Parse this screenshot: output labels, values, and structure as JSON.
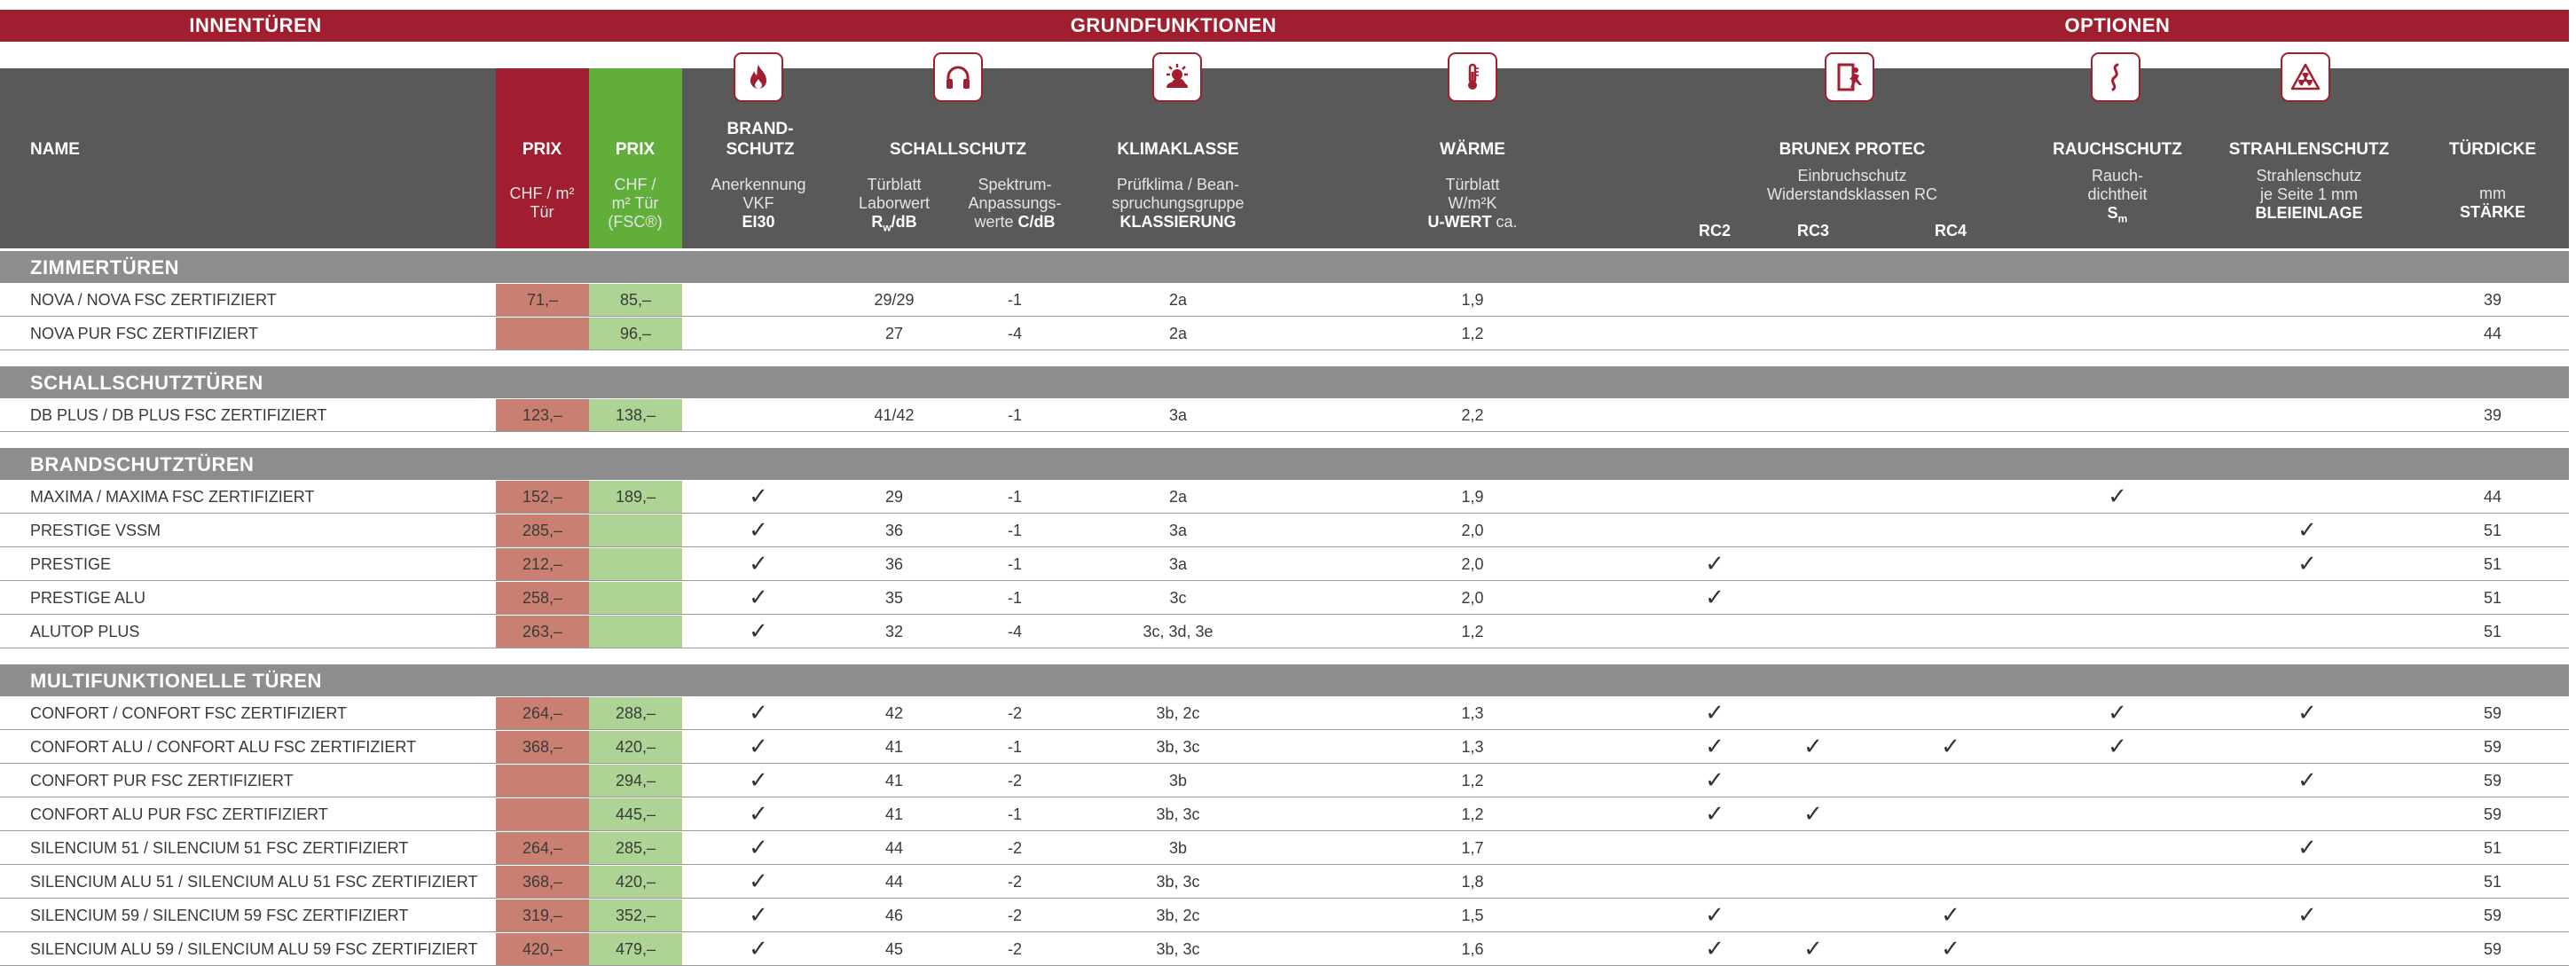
{
  "top_band": {
    "innenturen": "INNENTÜREN",
    "grundfunktionen": "GRUNDFUNKTIONEN",
    "optionen": "OPTIONEN"
  },
  "icons": [
    "flame-icon",
    "headphones-icon",
    "climate-icon",
    "thermometer-icon",
    "intruder-door-icon",
    "smoke-icon",
    "radiation-icon"
  ],
  "headers": {
    "name": "NAME",
    "prix1": "PRIX",
    "prix2": "PRIX",
    "brand1": "BRAND-",
    "brand2": "SCHUTZ",
    "schall": "SCHALLSCHUTZ",
    "klima": "KLIMAKLASSE",
    "warme": "WÄRME",
    "brunex": "BRUNEX PROTEC",
    "rauch": "RAUCHSCHUTZ",
    "strahlen": "STRAHLENSCHUTZ",
    "turdicke": "TÜRDICKE"
  },
  "subheaders": {
    "prix1_a": "CHF / m²",
    "prix1_b": "Tür",
    "prix2_a": "CHF /",
    "prix2_b": "m² Tür",
    "prix2_c": "(FSC®)",
    "brand_a": "Anerkennung",
    "brand_b": "VKF",
    "brand_c": "EI30",
    "labor_a": "Türblatt",
    "labor_b": "Laborwert",
    "labor_c": "Rw/dB",
    "spek_a": "Spektrum-",
    "spek_b": "Anpassungs-",
    "spek_c1": "werte ",
    "spek_c2": "C/dB",
    "klima_a": "Prüfklima / Bean-",
    "klima_b": "spruchungsgruppe",
    "klima_c": "KLASSIERUNG",
    "warme_a": "Türblatt",
    "warme_b": "W/m²K",
    "warme_c1": "U-WERT",
    "warme_c2": " ca.",
    "brunex_a": "Einbruchschutz",
    "brunex_b": "Widerstandsklassen RC",
    "rc2": "RC2",
    "rc3": "RC3",
    "rc4": "RC4",
    "rauch_a": "Rauch-",
    "rauch_b": "dichtheit",
    "rauch_c": "Sm",
    "strahl_a": "Strahlenschutz",
    "strahl_b": "je Seite 1 mm",
    "strahl_c": "BLEIEINLAGE",
    "dicke_a": "mm",
    "dicke_b": "STÄRKE"
  },
  "sections": [
    {
      "title": "ZIMMERTÜREN",
      "rows": [
        {
          "name": "NOVA / NOVA FSC ZERTIFIZIERT",
          "prix": "71,–",
          "prix_fsc": "85,–",
          "brand": "",
          "rw": "29/29",
          "c": "-1",
          "klima": "2a",
          "u": "1,9",
          "rc2": "",
          "rc3": "",
          "rc4": "",
          "rauch": "",
          "strahl": "",
          "mm": "39"
        },
        {
          "name": "NOVA PUR FSC ZERTIFIZIERT",
          "prix": "",
          "prix_fsc": "96,–",
          "brand": "",
          "rw": "27",
          "c": "-4",
          "klima": "2a",
          "u": "1,2",
          "rc2": "",
          "rc3": "",
          "rc4": "",
          "rauch": "",
          "strahl": "",
          "mm": "44"
        }
      ]
    },
    {
      "title": "SCHALLSCHUTZTÜREN",
      "rows": [
        {
          "name": "DB PLUS / DB PLUS FSC ZERTIFIZIERT",
          "prix": "123,–",
          "prix_fsc": "138,–",
          "brand": "",
          "rw": "41/42",
          "c": "-1",
          "klima": "3a",
          "u": "2,2",
          "rc2": "",
          "rc3": "",
          "rc4": "",
          "rauch": "",
          "strahl": "",
          "mm": "39"
        }
      ]
    },
    {
      "title": "BRANDSCHUTZTÜREN",
      "rows": [
        {
          "name": "MAXIMA / MAXIMA FSC ZERTIFIZIERT",
          "prix": "152,–",
          "prix_fsc": "189,–",
          "brand": "✓",
          "rw": "29",
          "c": "-1",
          "klima": "2a",
          "u": "1,9",
          "rc2": "",
          "rc3": "",
          "rc4": "",
          "rauch": "✓",
          "strahl": "",
          "mm": "44"
        },
        {
          "name": "PRESTIGE VSSM",
          "prix": "285,–",
          "prix_fsc": "",
          "brand": "✓",
          "rw": "36",
          "c": "-1",
          "klima": "3a",
          "u": "2,0",
          "rc2": "",
          "rc3": "",
          "rc4": "",
          "rauch": "",
          "strahl": "✓",
          "mm": "51"
        },
        {
          "name": "PRESTIGE",
          "prix": "212,–",
          "prix_fsc": "",
          "brand": "✓",
          "rw": "36",
          "c": "-1",
          "klima": "3a",
          "u": "2,0",
          "rc2": "✓",
          "rc3": "",
          "rc4": "",
          "rauch": "",
          "strahl": "✓",
          "mm": "51"
        },
        {
          "name": "PRESTIGE ALU",
          "prix": "258,–",
          "prix_fsc": "",
          "brand": "✓",
          "rw": "35",
          "c": "-1",
          "klima": "3c",
          "u": "2,0",
          "rc2": "✓",
          "rc3": "",
          "rc4": "",
          "rauch": "",
          "strahl": "",
          "mm": "51"
        },
        {
          "name": "ALUTOP PLUS",
          "prix": "263,–",
          "prix_fsc": "",
          "brand": "✓",
          "rw": "32",
          "c": "-4",
          "klima": "3c, 3d, 3e",
          "u": "1,2",
          "rc2": "",
          "rc3": "",
          "rc4": "",
          "rauch": "",
          "strahl": "",
          "mm": "51"
        }
      ]
    },
    {
      "title": "MULTIFUNKTIONELLE TÜREN",
      "rows": [
        {
          "name": "CONFORT / CONFORT FSC ZERTIFIZIERT",
          "prix": "264,–",
          "prix_fsc": "288,–",
          "brand": "✓",
          "rw": "42",
          "c": "-2",
          "klima": "3b, 2c",
          "u": "1,3",
          "rc2": "✓",
          "rc3": "",
          "rc4": "",
          "rauch": "✓",
          "strahl": "✓",
          "mm": "59"
        },
        {
          "name": "CONFORT ALU / CONFORT ALU FSC ZERTIFIZIERT",
          "prix": "368,–",
          "prix_fsc": "420,–",
          "brand": "✓",
          "rw": "41",
          "c": "-1",
          "klima": "3b, 3c",
          "u": "1,3",
          "rc2": "✓",
          "rc3": "✓",
          "rc4": "✓",
          "rauch": "✓",
          "strahl": "",
          "mm": "59"
        },
        {
          "name": "CONFORT PUR FSC ZERTIFIZIERT",
          "prix": "",
          "prix_fsc": "294,–",
          "brand": "✓",
          "rw": "41",
          "c": "-2",
          "klima": "3b",
          "u": "1,2",
          "rc2": "✓",
          "rc3": "",
          "rc4": "",
          "rauch": "",
          "strahl": "✓",
          "mm": "59"
        },
        {
          "name": "CONFORT ALU PUR FSC ZERTIFIZIERT",
          "prix": "",
          "prix_fsc": "445,–",
          "brand": "✓",
          "rw": "41",
          "c": "-1",
          "klima": "3b, 3c",
          "u": "1,2",
          "rc2": "✓",
          "rc3": "✓",
          "rc4": "",
          "rauch": "",
          "strahl": "",
          "mm": "59"
        },
        {
          "name": "SILENCIUM 51 / SILENCIUM 51 FSC ZERTIFIZIERT",
          "prix": "264,–",
          "prix_fsc": "285,–",
          "brand": "✓",
          "rw": "44",
          "c": "-2",
          "klima": "3b",
          "u": "1,7",
          "rc2": "",
          "rc3": "",
          "rc4": "",
          "rauch": "",
          "strahl": "✓",
          "mm": "51"
        },
        {
          "name": "SILENCIUM ALU 51 / SILENCIUM ALU 51 FSC ZERTIFIZIERT",
          "prix": "368,–",
          "prix_fsc": "420,–",
          "brand": "✓",
          "rw": "44",
          "c": "-2",
          "klima": "3b, 3c",
          "u": "1,8",
          "rc2": "",
          "rc3": "",
          "rc4": "",
          "rauch": "",
          "strahl": "",
          "mm": "51"
        },
        {
          "name": "SILENCIUM 59 / SILENCIUM 59 FSC ZERTIFIZIERT",
          "prix": "319,–",
          "prix_fsc": "352,–",
          "brand": "✓",
          "rw": "46",
          "c": "-2",
          "klima": "3b, 2c",
          "u": "1,5",
          "rc2": "✓",
          "rc3": "",
          "rc4": "✓",
          "rauch": "",
          "strahl": "✓",
          "mm": "59"
        },
        {
          "name": "SILENCIUM ALU 59 / SILENCIUM ALU 59 FSC ZERTIFIZIERT",
          "prix": "420,–",
          "prix_fsc": "479,–",
          "brand": "✓",
          "rw": "45",
          "c": "-2",
          "klima": "3b, 3c",
          "u": "1,6",
          "rc2": "✓",
          "rc3": "✓",
          "rc4": "✓",
          "rauch": "",
          "strahl": "",
          "mm": "59"
        }
      ]
    }
  ]
}
